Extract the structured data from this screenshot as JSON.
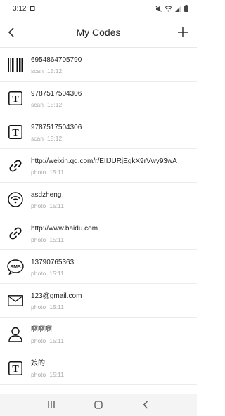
{
  "status_bar": {
    "time": "3:12"
  },
  "app_bar": {
    "title": "My Codes"
  },
  "items": [
    {
      "icon": "barcode-icon",
      "value": "6954864705790",
      "source": "scan",
      "time": "15:12"
    },
    {
      "icon": "text-icon",
      "value": "9787517504306",
      "source": "scan",
      "time": "15:12"
    },
    {
      "icon": "text-icon",
      "value": "9787517504306",
      "source": "scan",
      "time": "15:12"
    },
    {
      "icon": "link-icon",
      "value": "http://weixin.qq.com/r/EIIJURjEgkX9rVwy93wA",
      "source": "photo",
      "time": "15:11"
    },
    {
      "icon": "wifi-icon",
      "value": "asdzheng",
      "source": "photo",
      "time": "15:11"
    },
    {
      "icon": "link-icon",
      "value": "http://www.baidu.com",
      "source": "photo",
      "time": "15:11"
    },
    {
      "icon": "sms-icon",
      "value": "13790765363",
      "source": "photo",
      "time": "15:11"
    },
    {
      "icon": "email-icon",
      "value": "123@gmail.com",
      "source": "photo",
      "time": "15:11"
    },
    {
      "icon": "contact-icon",
      "value": "啊啊啊",
      "source": "photo",
      "time": "15:11"
    },
    {
      "icon": "text-icon",
      "value": "娘的",
      "source": "photo",
      "time": "15:11"
    }
  ]
}
